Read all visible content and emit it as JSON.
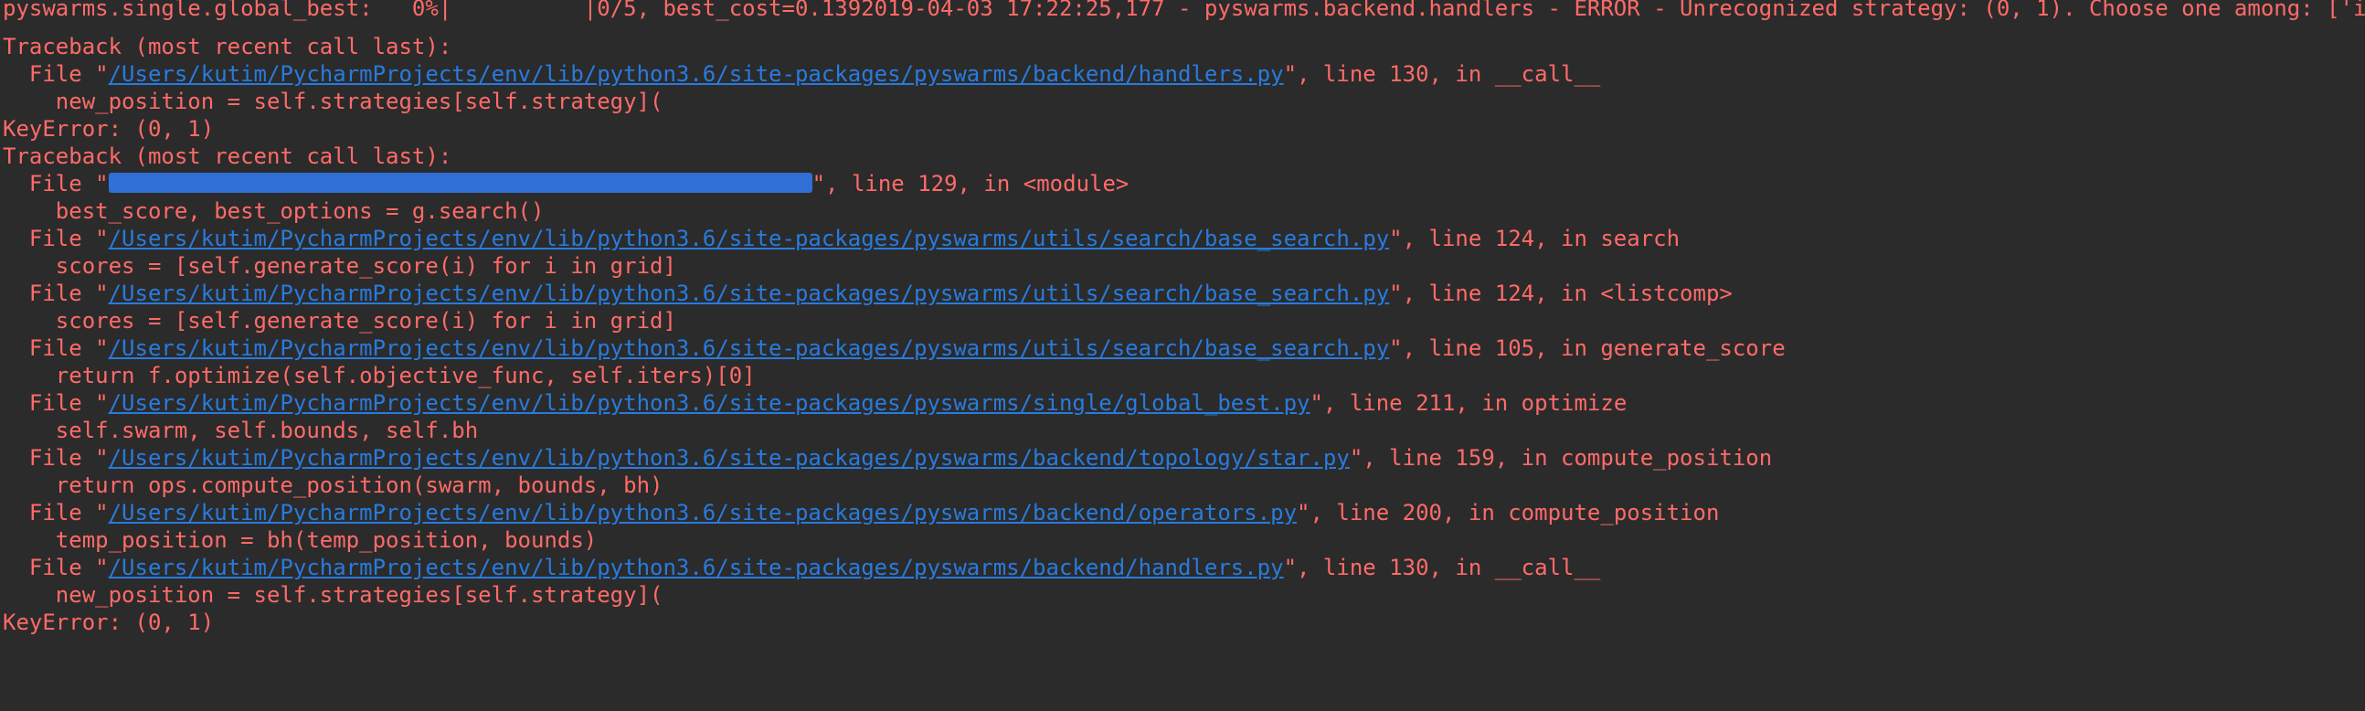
{
  "console": {
    "lines": [
      {
        "text": "pyswarms.single.global_best:   0%|          |0/5, best_cost=0.1392019-04-03 17:22:25,177 - pyswarms.backend.handlers - ERROR - Unrecognized strategy: (0, 1). Choose one among: ['intermediate', 'nearest', 'random', 'shrink']"
      },
      {
        "text": "Traceback (most recent call last):"
      },
      {
        "prefix": "  File \"",
        "link": "/Users/kutim/PycharmProjects/env/lib/python3.6/site-packages/pyswarms/backend/handlers.py",
        "suffix": "\", line 130, in __call__"
      },
      {
        "text": "    new_position = self.strategies[self.strategy]("
      },
      {
        "text": "KeyError: (0, 1)"
      },
      {
        "text": "Traceback (most recent call last):"
      },
      {
        "prefix": "  File \"",
        "redacted": true,
        "suffix": "\", line 129, in <module>"
      },
      {
        "text": "    best_score, best_options = g.search()"
      },
      {
        "prefix": "  File \"",
        "link": "/Users/kutim/PycharmProjects/env/lib/python3.6/site-packages/pyswarms/utils/search/base_search.py",
        "suffix": "\", line 124, in search"
      },
      {
        "text": "    scores = [self.generate_score(i) for i in grid]"
      },
      {
        "prefix": "  File \"",
        "link": "/Users/kutim/PycharmProjects/env/lib/python3.6/site-packages/pyswarms/utils/search/base_search.py",
        "suffix": "\", line 124, in <listcomp>"
      },
      {
        "text": "    scores = [self.generate_score(i) for i in grid]"
      },
      {
        "prefix": "  File \"",
        "link": "/Users/kutim/PycharmProjects/env/lib/python3.6/site-packages/pyswarms/utils/search/base_search.py",
        "suffix": "\", line 105, in generate_score"
      },
      {
        "text": "    return f.optimize(self.objective_func, self.iters)[0]"
      },
      {
        "prefix": "  File \"",
        "link": "/Users/kutim/PycharmProjects/env/lib/python3.6/site-packages/pyswarms/single/global_best.py",
        "suffix": "\", line 211, in optimize"
      },
      {
        "text": "    self.swarm, self.bounds, self.bh"
      },
      {
        "prefix": "  File \"",
        "link": "/Users/kutim/PycharmProjects/env/lib/python3.6/site-packages/pyswarms/backend/topology/star.py",
        "suffix": "\", line 159, in compute_position"
      },
      {
        "text": "    return ops.compute_position(swarm, bounds, bh)"
      },
      {
        "prefix": "  File \"",
        "link": "/Users/kutim/PycharmProjects/env/lib/python3.6/site-packages/pyswarms/backend/operators.py",
        "suffix": "\", line 200, in compute_position"
      },
      {
        "text": "    temp_position = bh(temp_position, bounds)"
      },
      {
        "prefix": "  File \"",
        "link": "/Users/kutim/PycharmProjects/env/lib/python3.6/site-packages/pyswarms/backend/handlers.py",
        "suffix": "\", line 130, in __call__"
      },
      {
        "text": "    new_position = self.strategies[self.strategy]("
      },
      {
        "text": "KeyError: (0, 1)"
      }
    ]
  },
  "colors": {
    "background": "#2b2b2b",
    "error_text": "#ff6b68",
    "link": "#287bde",
    "redaction": "#2f6fd6"
  }
}
